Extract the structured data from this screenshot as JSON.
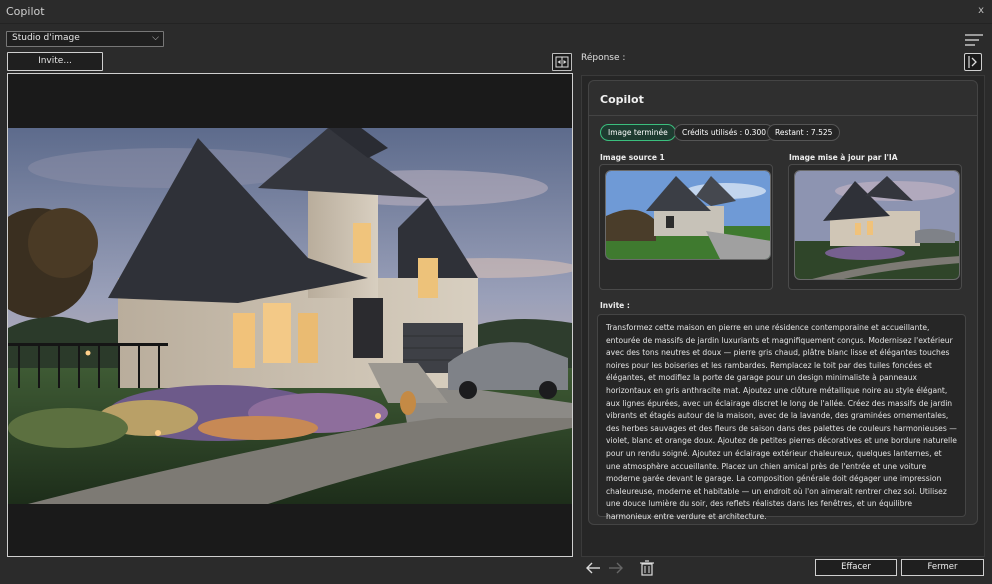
{
  "window": {
    "title": "Copilot",
    "close_glyph": "x"
  },
  "toolbar": {
    "studio_select_value": "Studio d'image",
    "invite_button": "Invite..."
  },
  "response": {
    "label": "Réponse :",
    "card_title": "Copilot",
    "badges": {
      "status": "Image terminée",
      "credits": "Crédits utilisés : 0.300",
      "remaining": "Restant : 7.525"
    },
    "source_label": "Image source 1",
    "updated_label": "Image mise à jour par l'IA",
    "invite_label": "Invite :",
    "prompt_text": "Transformez cette maison en pierre en une résidence contemporaine et accueillante, entourée de massifs de jardin luxuriants et magnifiquement conçus. Modernisez l'extérieur avec des tons neutres et doux — pierre gris chaud, plâtre blanc lisse et élégantes touches noires pour les boiseries et les rambardes. Remplacez le toit par des tuiles foncées et élégantes, et modifiez la porte de garage pour un design minimaliste à panneaux horizontaux en gris anthracite mat. Ajoutez une clôture métallique noire au style élégant, aux lignes épurées, avec un éclairage discret le long de l'allée. Créez des massifs de jardin vibrants et étagés autour de la maison, avec de la lavande, des graminées ornementales, des herbes sauvages et des fleurs de saison dans des palettes de couleurs harmonieuses — violet, blanc et orange doux. Ajoutez de petites pierres décoratives et une bordure naturelle pour un rendu soigné. Ajoutez un éclairage extérieur chaleureux, quelques lanternes, et une atmosphère accueillante. Placez un chien amical près de l'entrée et une voiture moderne garée devant le garage. La composition générale doit dégager une impression chaleureuse, moderne et habitable — un endroit où l'on aimerait rentrer chez soi. Utilisez une douce lumière du soir, des reflets réalistes dans les fenêtres, et un équilibre harmonieux entre verdure et architecture."
  },
  "footer": {
    "clear_button": "Effacer",
    "close_button": "Fermer"
  },
  "colors": {
    "accent_green": "#3bbf7e",
    "background": "#2b2b2b"
  },
  "icons": [
    "chevron-down-icon",
    "swap-panels-icon",
    "menu-lines-icon",
    "collapse-panel-icon",
    "arrow-left-icon",
    "arrow-right-icon",
    "trash-icon"
  ]
}
